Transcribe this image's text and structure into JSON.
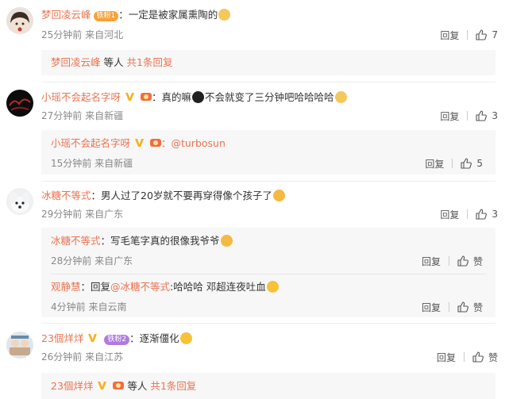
{
  "comments": [
    {
      "user": "梦回凌云峰",
      "badge": "铁粉1",
      "text_prefix": "：一定是被家属熏陶的",
      "time": "25分钟前",
      "location": "来自河北",
      "reply_label": "回复",
      "likes": "7",
      "summary": {
        "user": "梦回凌云峰",
        "middle": "等人",
        "link": "共1条回复"
      }
    },
    {
      "user": "小瑶不会起名字呀",
      "text_prefix": "：真的嘛",
      "text_suffix": "不会就变了三分钟吧哈哈哈哈",
      "time": "27分钟前",
      "location": "来自新疆",
      "reply_label": "回复",
      "likes": "3",
      "replies": [
        {
          "user": "小瑶不会起名字呀",
          "text": "：@turbosun",
          "time": "15分钟前",
          "location": "来自新疆",
          "reply_label": "回复",
          "likes": "5"
        }
      ]
    },
    {
      "user": "冰糖不等式",
      "text_prefix": "：男人过了20岁就不要再穿得像个孩子了",
      "time": "29分钟前",
      "location": "来自广东",
      "reply_label": "回复",
      "likes": "3",
      "replies": [
        {
          "user": "冰糖不等式",
          "text": "：写毛笔字真的很像我爷爷",
          "time": "28分钟前",
          "location": "来自广东",
          "reply_label": "回复",
          "likes": "赞"
        },
        {
          "user": "观静慧",
          "text_a": "：回复",
          "mention": "@冰糖不等式",
          "text_b": ":哈哈哈 邓超连夜吐血",
          "time": "4分钟前",
          "location": "来自云南",
          "reply_label": "回复",
          "likes": "赞"
        }
      ]
    },
    {
      "user": "23個烊烊",
      "badge": "铁粉2",
      "text_prefix": "：逐渐僵化",
      "time": "26分钟前",
      "location": "来自江苏",
      "reply_label": "回复",
      "likes": "赞",
      "summary": {
        "user": "23個烊烊",
        "middle": "等人",
        "link": "共1条回复"
      }
    }
  ],
  "colors": {
    "accent": "#eb7350",
    "meta": "#888888",
    "reply_bg": "#f7f7f7"
  }
}
